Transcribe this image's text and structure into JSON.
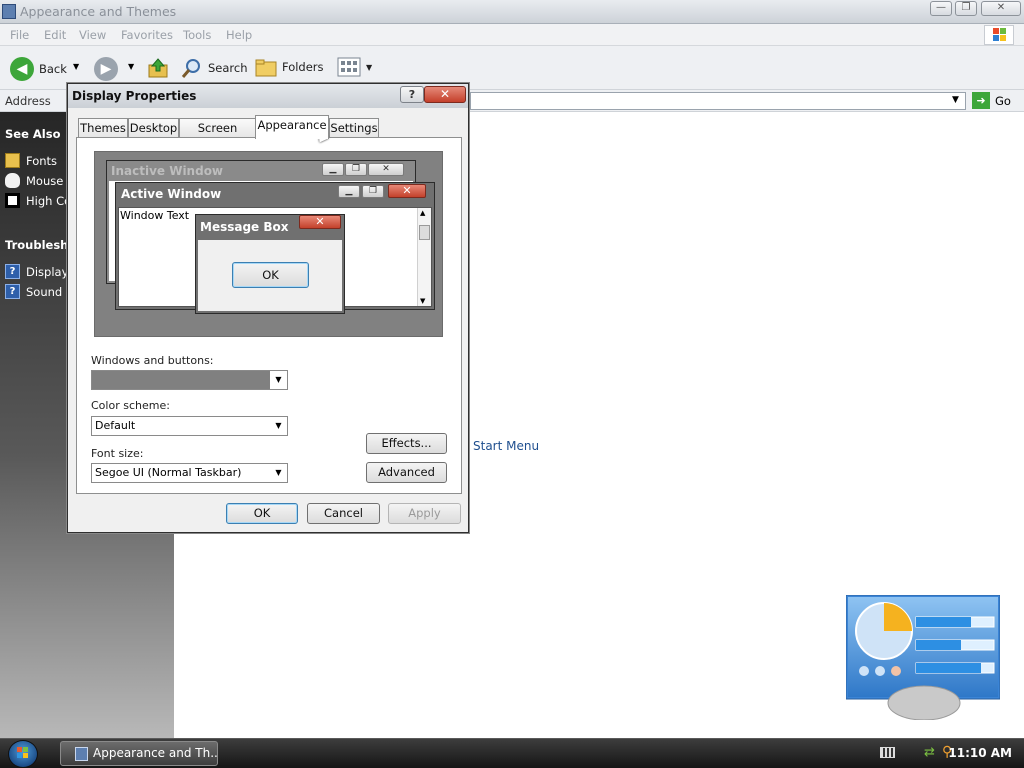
{
  "window": {
    "title": "Appearance and Themes",
    "controls": {
      "minimize": "—",
      "maximize": "❐",
      "close": "✕"
    }
  },
  "menubar": {
    "items": [
      "File",
      "Edit",
      "View",
      "Favorites",
      "Tools",
      "Help"
    ]
  },
  "toolbar": {
    "back": "Back",
    "search": "Search",
    "folders": "Folders"
  },
  "address": {
    "label": "Address",
    "go": "Go"
  },
  "sidebar": {
    "see_also_header": "See Also",
    "see_also": [
      "Fonts",
      "Mouse",
      "High Co"
    ],
    "troubleshooters_header": "Troubleshoo",
    "troubleshooters": [
      "Display",
      "Sound"
    ]
  },
  "content": {
    "task_link": "Start Menu"
  },
  "dialog": {
    "title": "Display Properties",
    "help_btn": "?",
    "close_btn": "✕",
    "tabs": [
      "Themes",
      "Desktop",
      "Screen Saver",
      "Appearance",
      "Settings"
    ],
    "selected_tab": "Appearance",
    "preview": {
      "inactive_title": "Inactive Window",
      "active_title": "Active Window",
      "window_text": "Window Text",
      "message_box_title": "Message Box",
      "message_box_ok": "OK"
    },
    "windows_buttons_label": "Windows and buttons:",
    "windows_buttons_value": "",
    "color_scheme_label": "Color scheme:",
    "color_scheme_value": "Default",
    "font_size_label": "Font size:",
    "font_size_value": "Segoe UI (Normal Taskbar)",
    "effects_btn": "Effects...",
    "advanced_btn": "Advanced",
    "ok": "OK",
    "cancel": "Cancel",
    "apply": "Apply"
  },
  "taskbar": {
    "item": "Appearance and Th...",
    "time": "11:10 AM"
  },
  "colors": {
    "accent_red": "#c4402b",
    "panel_blue": "#3a84d6",
    "preview_gray": "#818181"
  }
}
